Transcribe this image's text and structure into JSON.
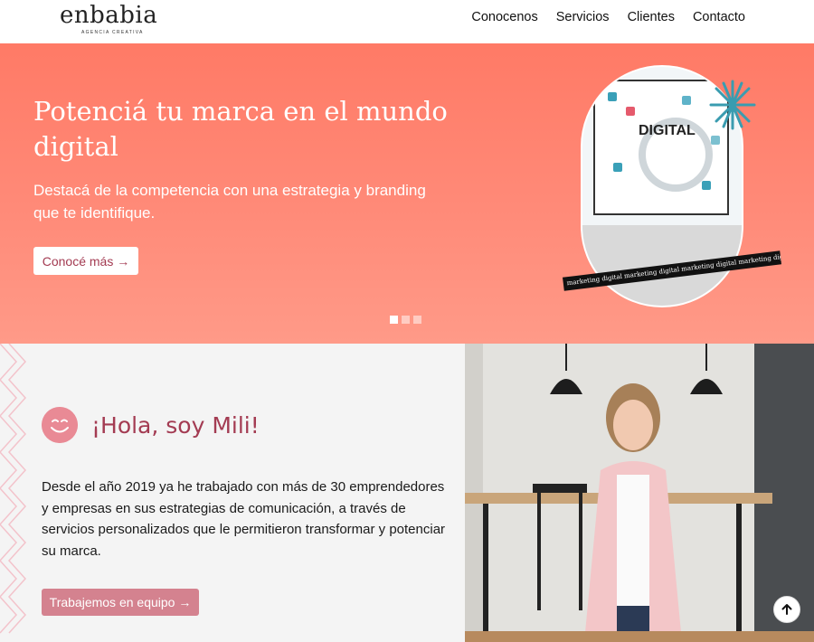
{
  "header": {
    "logo_text": "enbabia",
    "logo_tagline": "AGENCIA CREATIVA",
    "nav": [
      "Conocenos",
      "Servicios",
      "Clientes",
      "Contacto"
    ]
  },
  "hero": {
    "title": "Potenciá tu marca en el mundo digital",
    "subtitle": "Destacá de la competencia con una estrategia y branding que te identifique.",
    "cta": "Conocé más →",
    "image_word": "DIGITAL",
    "ribbon_text": "marketing digital  marketing digital  marketing digital  marketing digital",
    "slides": 3,
    "active_slide": 1
  },
  "about": {
    "title": "¡Hola, soy Mili!",
    "text": "Desde el año 2019 ya he trabajado con más de 30 emprendedores y empresas en sus estrategias de comunicación, a través de servicios personalizados que le permitieron transformar y potenciar su marca.",
    "cta": "Trabajemos en equipo →"
  },
  "colors": {
    "hero_bg": "#ff7f6d",
    "accent": "#a33b52",
    "button_pink": "#d4828f",
    "section_bg": "#f4f4f4"
  },
  "icons": [
    "smiley-icon",
    "arrow-up-icon",
    "starburst-icon"
  ]
}
